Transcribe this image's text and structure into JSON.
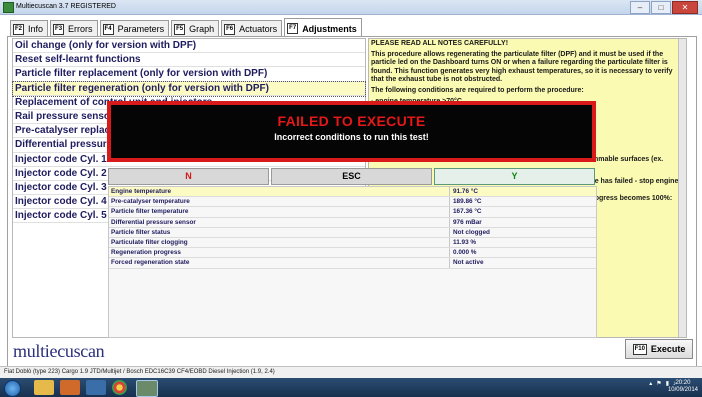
{
  "window": {
    "title": "Multiecuscan 3.7 REGISTERED",
    "min_label": "–",
    "max_label": "□",
    "close_label": "✕"
  },
  "tabs": [
    {
      "key": "F2",
      "label": "Info"
    },
    {
      "key": "F3",
      "label": "Errors"
    },
    {
      "key": "F4",
      "label": "Parameters"
    },
    {
      "key": "F5",
      "label": "Graph"
    },
    {
      "key": "F6",
      "label": "Actuators"
    },
    {
      "key": "F7",
      "label": "Adjustments"
    }
  ],
  "procedures": [
    "Oil change (only for version with DPF)",
    "Reset self-learnt functions",
    "Particle filter replacement (only for version with DPF)",
    "Particle filter regeneration (only for version with DPF)",
    "Replacement of control unit and injectors",
    "Rail pressure sensor",
    "Pre-catalyser replace",
    "Differential pressure",
    "Injector code Cyl. 1",
    "Injector code Cyl. 2",
    "Injector code Cyl. 3",
    "Injector code Cyl. 4",
    "Injector code Cyl. 5"
  ],
  "notes": {
    "line1": "PLEASE READ ALL NOTES CAREFULLY!",
    "line2": "This procedure allows regenerating the particulate filter (DPF) and it must be used if the particle led on the Dashboard turns ON or when a failure regarding the particulate filter is found. This function generates very high exhaust temperatures, so it is necessary to verify that the exhaust tube is not obstructed.",
    "line3": "The following conditions are required to perform the procedure:",
    "line4": "- engine temperature >70°C",
    "frag1": "mmable surfaces (ex.",
    "frag2": "re has failed - stop engine",
    "frag3": "rogress becomes 100%:"
  },
  "dialog": {
    "title": "FAILED TO EXECUTE",
    "message": "Incorrect conditions to run this test!"
  },
  "buttons": {
    "n": "N",
    "esc": "ESC",
    "y": "Y"
  },
  "parameters": [
    {
      "name": "Engine temperature",
      "value": "91.76 °C"
    },
    {
      "name": "Pre-catalyser temperature",
      "value": "189.86 °C"
    },
    {
      "name": "Particle filter temperature",
      "value": "167.36 °C"
    },
    {
      "name": "Differential pressure sensor",
      "value": "976 mBar"
    },
    {
      "name": "Particle filter status",
      "value": "Not clogged"
    },
    {
      "name": "Particulate filter clogging",
      "value": "11.93 %"
    },
    {
      "name": "Regeneration progress",
      "value": "0.000 %"
    },
    {
      "name": "Forced regeneration state",
      "value": "Not active"
    }
  ],
  "footer": {
    "logo": "multiecuscan",
    "execute_key": "F10",
    "execute_label": "Execute"
  },
  "status": "Fiat Doblò (type 223) Cargo 1.9 JTD/Multijet / Bosch EDC16C39 CF4/EOBD Diesel Injection (1.9, 2.4)",
  "taskbar": {
    "time": "20:20",
    "date": "10/09/2014"
  }
}
